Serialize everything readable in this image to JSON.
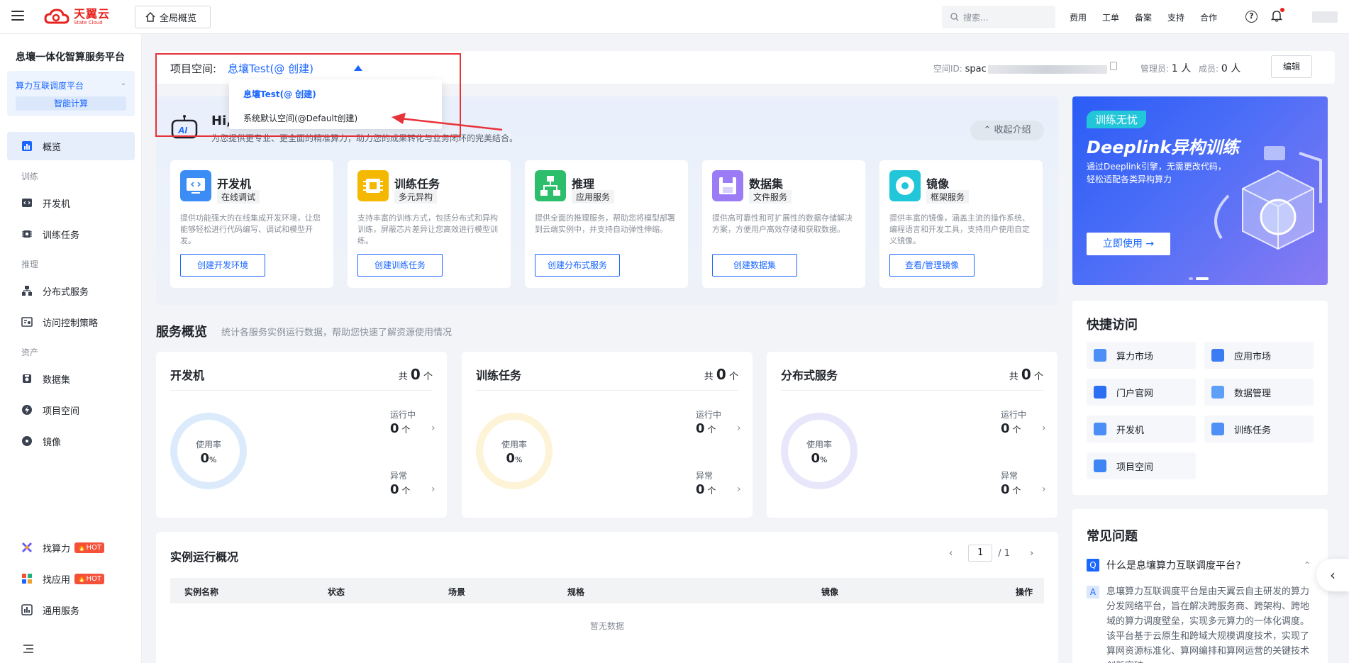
{
  "header": {
    "logo_cn": "天翼云",
    "logo_en": "State Cloud",
    "global_overview": "全局概览",
    "search_placeholder": "搜索...",
    "links": [
      "费用",
      "工单",
      "备案",
      "支持",
      "合作"
    ]
  },
  "sidebar": {
    "platform_title": "息壤一体化智算服务平台",
    "platform_name": "算力互联调度平台",
    "platform_sub": "智能计算",
    "overview": "概览",
    "group_train": "训练",
    "devbox": "开发机",
    "train_task": "训练任务",
    "group_infer": "推理",
    "distributed": "分布式服务",
    "access_policy": "访问控制策略",
    "group_asset": "资产",
    "dataset": "数据集",
    "project_space": "项目空间",
    "image": "镜像",
    "find_compute": "找算力",
    "find_app": "找应用",
    "hot": "HOT",
    "general_service": "通用服务"
  },
  "project": {
    "label": "项目空间:",
    "value": "息壤Test(@      创建)",
    "space_id_label": "空间ID:",
    "space_id_value": "spac",
    "admin_label": "管理员:",
    "admin_value": "1 人",
    "member_label": "成员:",
    "member_value": "0 人",
    "edit": "编辑"
  },
  "dropdown": {
    "selected": "息壤Test(@      创建)",
    "other": "系统默认空间(@Default创建)"
  },
  "intro": {
    "hi": "Hi,",
    "sub": "为您提供更专业、更全面的精准算力，助力您的成果转化与业务闭环的完美结合。",
    "collapse": "收起介绍",
    "features": [
      {
        "title": "开发机",
        "tag": "在线调试",
        "desc": "提供功能强大的在线集成开发环境，让您能够轻松进行代码编写、调试和模型开发。",
        "btn": "创建开发环境"
      },
      {
        "title": "训练任务",
        "tag": "多元异构",
        "desc": "支持丰富的训练方式，包括分布式和异构训练，屏蔽芯片差异让您高效进行模型训练。",
        "btn": "创建训练任务"
      },
      {
        "title": "推理",
        "tag": "应用服务",
        "desc": "提供全面的推理服务，帮助您将模型部署到云端实例中，并支持自动弹性伸缩。",
        "btn": "创建分布式服务"
      },
      {
        "title": "数据集",
        "tag": "文件服务",
        "desc": "提供高可靠性和可扩展性的数据存储解决方案，方便用户高效存储和获取数据。",
        "btn": "创建数据集"
      },
      {
        "title": "镜像",
        "tag": "框架服务",
        "desc": "提供丰富的镜像，涵盖主流的操作系统、编程语言和开发工具，支持用户使用自定义镜像。",
        "btn": "查看/管理镜像"
      }
    ]
  },
  "promo": {
    "tag": "训练无忧",
    "title": "Deeplink异构训练",
    "desc": "通过Deeplink引擎，无需更改代码，轻松适配各类异构算力",
    "btn": "立即使用 →"
  },
  "services": {
    "title": "服务概览",
    "sub": "统计各服务实例运行数据，帮助您快速了解资源使用情况",
    "total_prefix": "共",
    "unit": "个",
    "usage_label": "使用率",
    "running_label": "运行中",
    "error_label": "异常",
    "items": [
      {
        "name": "开发机",
        "total": "0",
        "usage": "0",
        "running": "0",
        "error": "0"
      },
      {
        "name": "训练任务",
        "total": "0",
        "usage": "0",
        "running": "0",
        "error": "0"
      },
      {
        "name": "分布式服务",
        "total": "0",
        "usage": "0",
        "running": "0",
        "error": "0"
      }
    ]
  },
  "quick": {
    "title": "快捷访问",
    "items": [
      "算力市场",
      "应用市场",
      "门户官网",
      "数据管理",
      "开发机",
      "训练任务",
      "项目空间"
    ]
  },
  "instances": {
    "title": "实例运行概况",
    "page": "1",
    "total_pages": "/ 1",
    "columns": [
      "实例名称",
      "状态",
      "场景",
      "规格",
      "镜像",
      "操作"
    ],
    "empty": "暂无数据"
  },
  "faq": {
    "title": "常见问题",
    "q_badge": "Q",
    "question": "什么是息壤算力互联调度平台?",
    "a_badge": "A",
    "answer": "息壤算力互联调度平台是由天翼云自主研发的算力分发网络平台，旨在解决跨服务商、跨架构、跨地域的算力调度壁垒，实现多元算力的一体化调度。该平台基于云原生和跨域大规模调度技术，实现了算网资源标准化、算网编排和算网运营的关键技术创新突破。"
  },
  "colors": {
    "primary": "#1a66ff",
    "brand_red": "#e8231f",
    "annotation": "#e8323a"
  }
}
